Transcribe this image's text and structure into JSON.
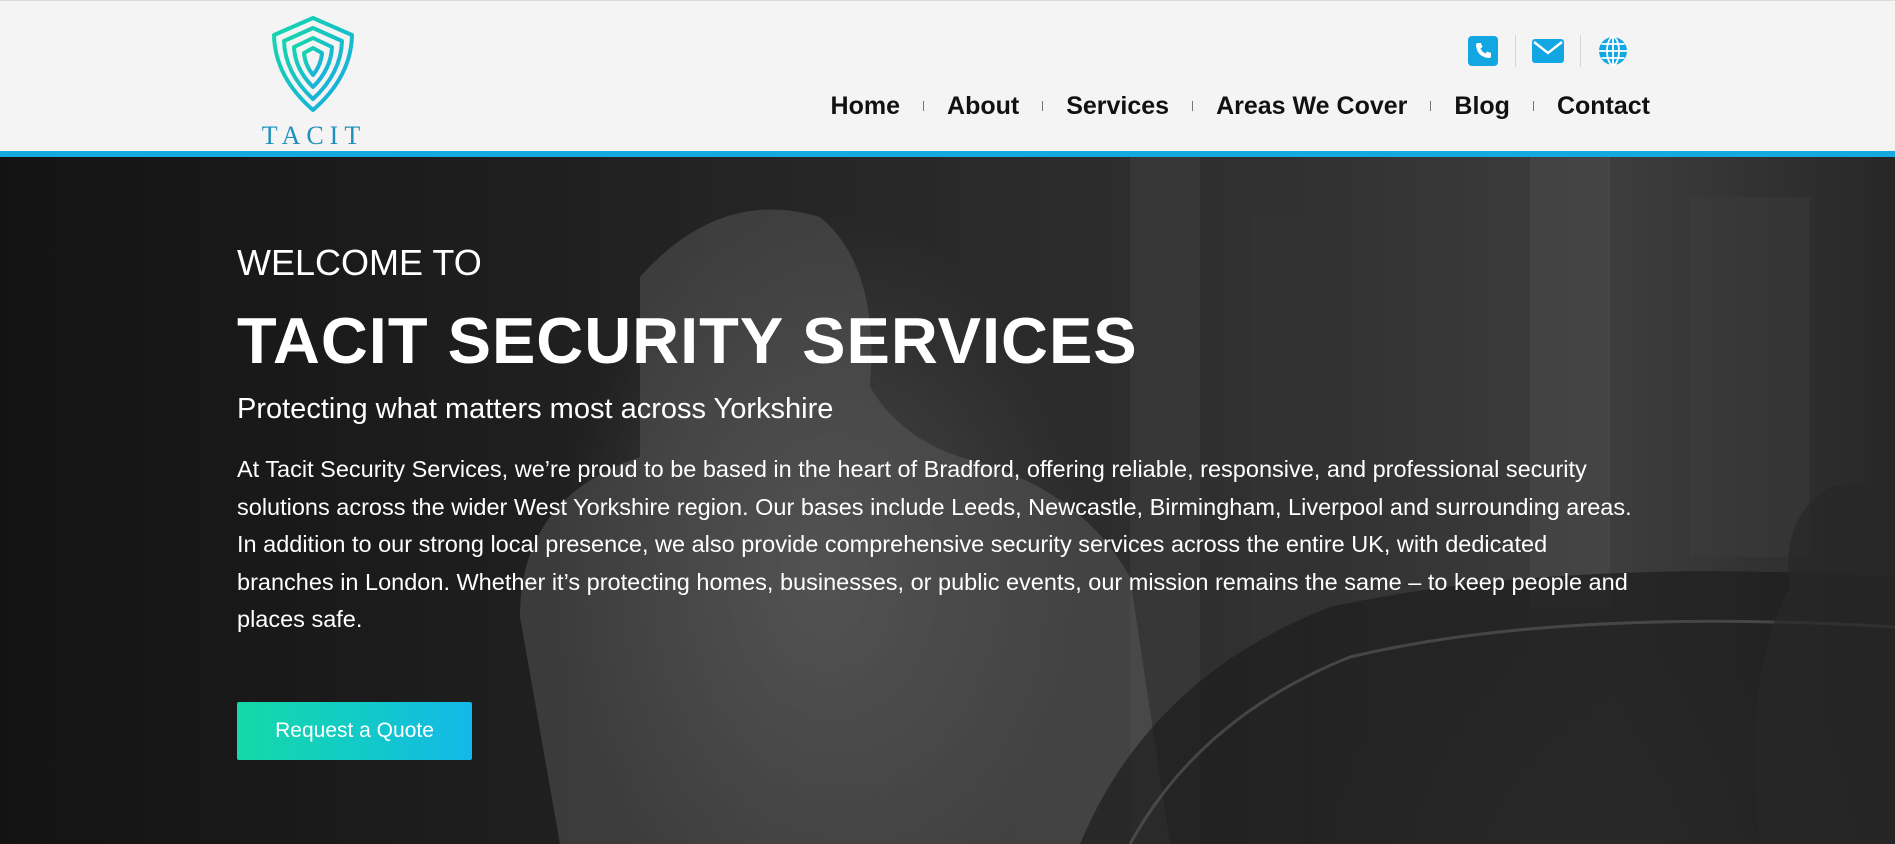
{
  "brand": {
    "name": "TACIT",
    "logo_icon": "shield-maze-icon",
    "accent_color": "#15a9dd",
    "gradient_colors": [
      "#14d9a8",
      "#13b8e8"
    ]
  },
  "header": {
    "contact_icons": [
      "phone-icon",
      "email-icon",
      "globe-icon"
    ],
    "nav": [
      {
        "label": "Home"
      },
      {
        "label": "About"
      },
      {
        "label": "Services"
      },
      {
        "label": "Areas We Cover"
      },
      {
        "label": "Blog"
      },
      {
        "label": "Contact"
      }
    ]
  },
  "hero": {
    "welcome": "WELCOME TO",
    "title": "TACIT SECURITY SERVICES",
    "subtitle": "Protecting what matters most across Yorkshire",
    "body": "At Tacit Security Services, we’re proud to be based in the heart of Bradford, offering reliable, responsive, and professional security solutions across the wider West Yorkshire region. Our bases include Leeds, Newcastle, Birmingham, Liverpool and surrounding areas. In addition to our strong local presence, we also provide comprehensive security services across the entire UK, with dedicated branches in London. Whether it’s protecting homes, businesses, or public events, our mission remains the same – to keep people and places safe.",
    "cta_label": "Request a Quote",
    "background_image": "security-guard-photo"
  }
}
